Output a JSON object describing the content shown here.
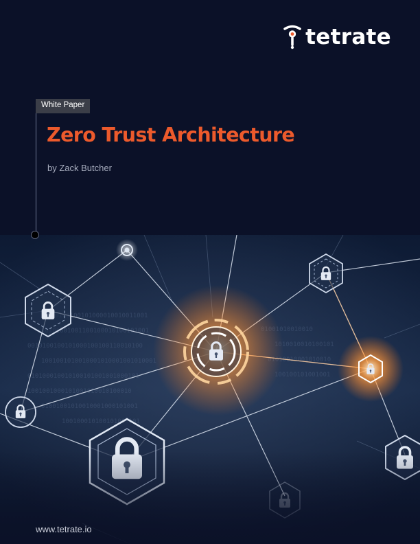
{
  "logo": {
    "text": "tetrate"
  },
  "tag": {
    "label": "White Paper"
  },
  "title": "Zero Trust Architecture",
  "author": "by Zack Butcher",
  "footer": {
    "url": "www.tetrate.io"
  },
  "colors": {
    "background": "#0b1128",
    "title": "#ec5a2c",
    "tag_background": "#3b3e48",
    "glow": "#ff9a3c"
  },
  "illustration": {
    "subject": "network of padlock nodes in hexagons with glowing connections over binary code",
    "icon": "padlock-icon"
  }
}
